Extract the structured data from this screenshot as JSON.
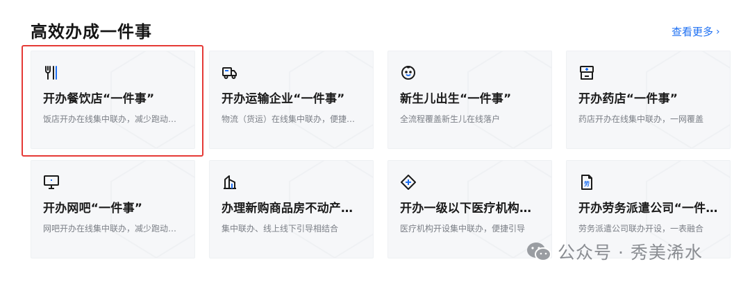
{
  "header": {
    "title": "高效办成一件事",
    "more_label": "查看更多"
  },
  "cards": [
    {
      "icon": "utensils-icon",
      "title": "开办餐饮店“一件事”",
      "desc": "饭店开办在线集中联办，减少跑动次数"
    },
    {
      "icon": "truck-icon",
      "title": "开办运输企业“一件事”",
      "desc": "物流（货运）在线集中联办，便捷引导"
    },
    {
      "icon": "baby-icon",
      "title": "新生儿出生“一件事”",
      "desc": "全流程覆盖新生儿在线落户"
    },
    {
      "icon": "pharmacy-icon",
      "title": "开办药店“一件事”",
      "desc": "药店开办在线集中联办，一网覆盖"
    },
    {
      "icon": "monitor-icon",
      "title": "开办网吧“一件事”",
      "desc": "网吧开办在线集中联办，减少跑动次数"
    },
    {
      "icon": "building-icon",
      "title": "办理新购商品房不动产权…",
      "desc": "集中联办、线上线下引导相结合"
    },
    {
      "icon": "medical-cross-icon",
      "title": "开办一级以下医疗机构（…",
      "desc": "医疗机构开设集中联办，便捷引导"
    },
    {
      "icon": "labor-document-icon",
      "title": "开办劳务派遣公司“一件…",
      "desc": "劳务派遣公司联办开设，一表融合"
    }
  ],
  "watermark": {
    "text": "公众号 · 秀美浠水",
    "icon": "wechat-icon"
  },
  "colors": {
    "link": "#1d6ff2",
    "card_bg": "#f6f7f9",
    "highlight": "#e53935",
    "title": "#141414",
    "desc": "#7b7f86"
  }
}
